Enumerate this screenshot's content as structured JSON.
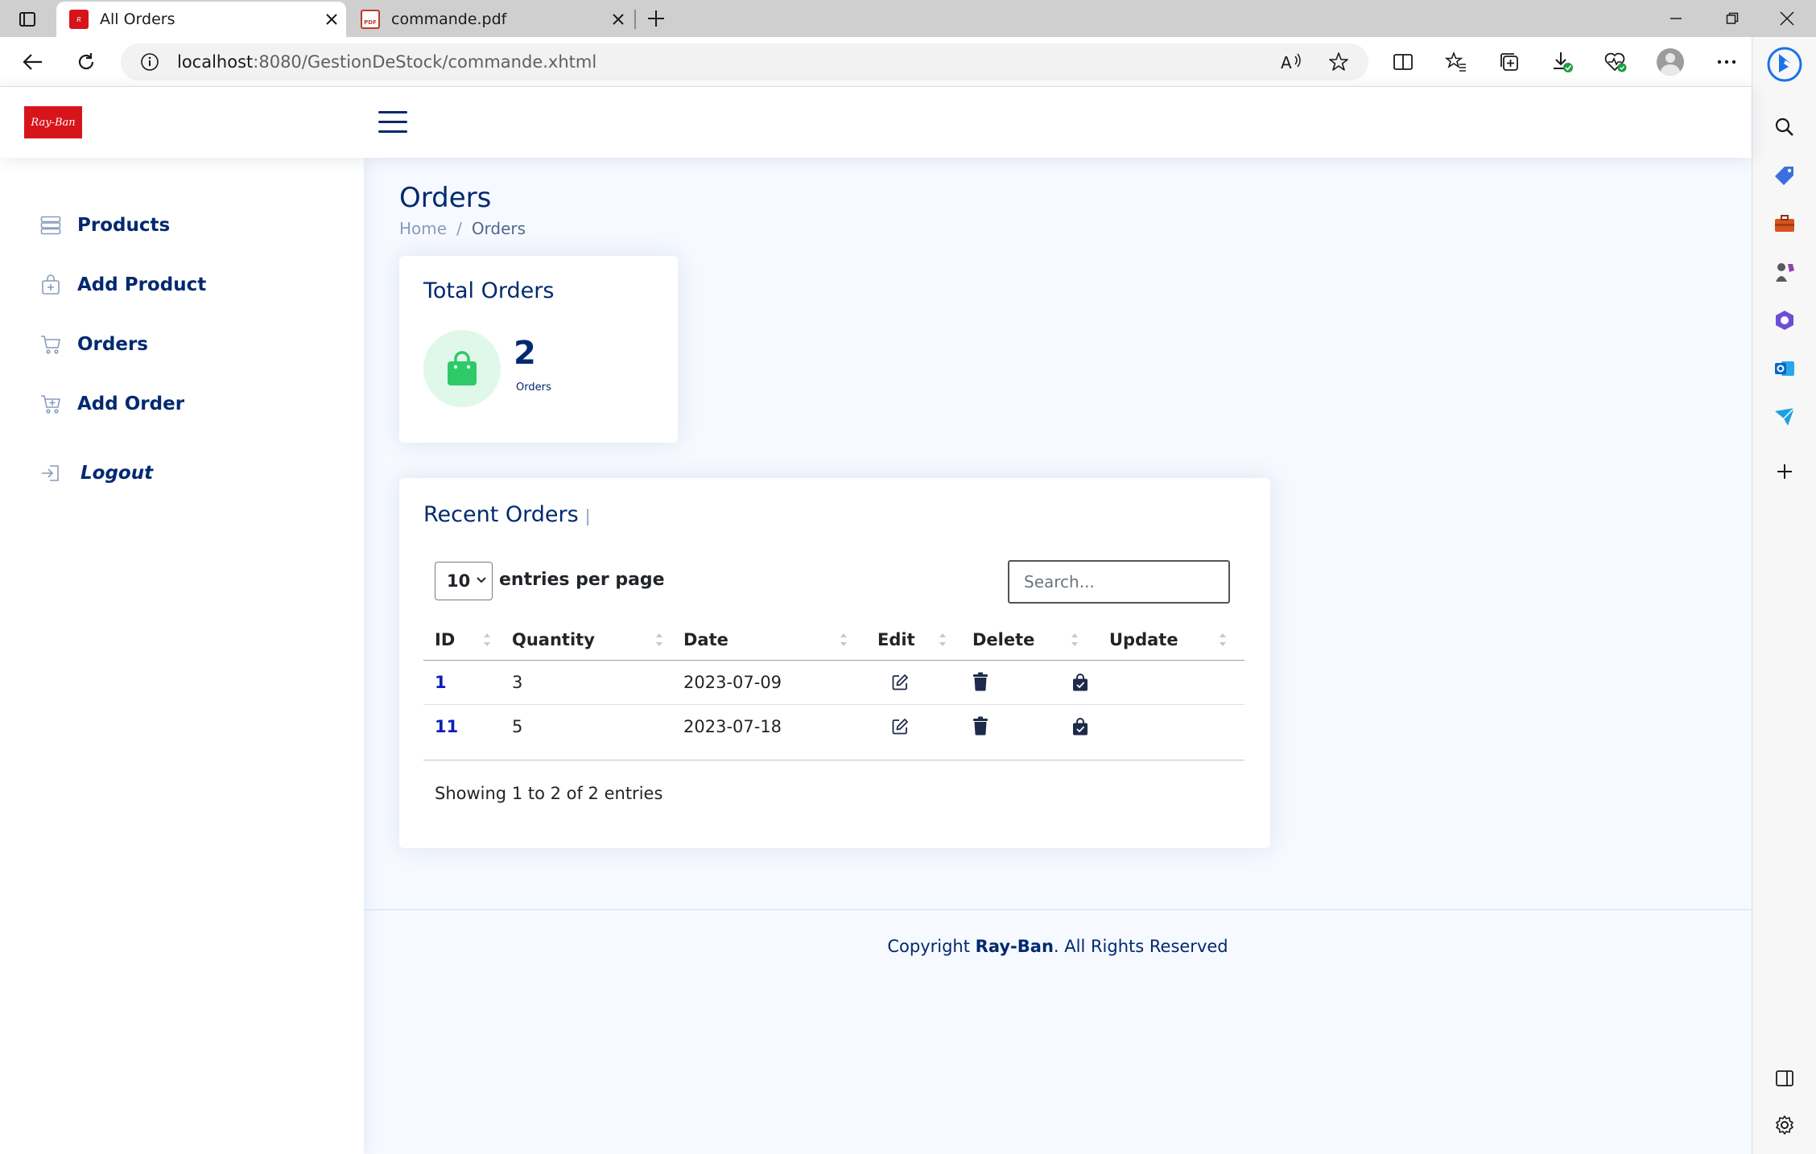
{
  "browser": {
    "tabs": [
      {
        "title": "All Orders",
        "active": true,
        "icon": "rayban-favicon"
      },
      {
        "title": "commande.pdf",
        "active": false,
        "icon": "pdf-icon"
      }
    ],
    "url_host": "localhost",
    "url_path": ":8080/GestionDeStock/commande.xhtml"
  },
  "app": {
    "logo_text": "Ray-Ban",
    "brand_color": "#d7141a",
    "accent_color": "#012970"
  },
  "sidebar": {
    "items": [
      {
        "label": "Products",
        "icon": "list-icon"
      },
      {
        "label": "Add Product",
        "icon": "bag-plus-icon"
      },
      {
        "label": "Orders",
        "icon": "cart-icon"
      },
      {
        "label": "Add Order",
        "icon": "cart-plus-icon"
      },
      {
        "label": "Logout",
        "icon": "logout-icon"
      }
    ]
  },
  "page": {
    "title": "Orders",
    "breadcrumb": {
      "home": "Home",
      "separator": "/",
      "current": "Orders"
    }
  },
  "total_card": {
    "title": "Total Orders",
    "count": "2",
    "unit": "Orders",
    "icon": "shopping-bag-icon",
    "icon_color": "#2eca6a"
  },
  "orders_card": {
    "title": "Recent Orders",
    "title_suffix": "|",
    "per_page_value": "10",
    "per_page_label": "entries per page",
    "search_placeholder": "Search...",
    "columns": [
      "ID",
      "Quantity",
      "Date",
      "Edit",
      "Delete",
      "Update"
    ],
    "rows": [
      {
        "id": "1",
        "quantity": "3",
        "date": "2023-07-09"
      },
      {
        "id": "11",
        "quantity": "5",
        "date": "2023-07-18"
      }
    ],
    "showing_text": "Showing 1 to 2 of 2 entries"
  },
  "footer": {
    "prefix": "Copyright",
    "brand": "Ray-Ban",
    "suffix": ". All Rights Reserved"
  }
}
